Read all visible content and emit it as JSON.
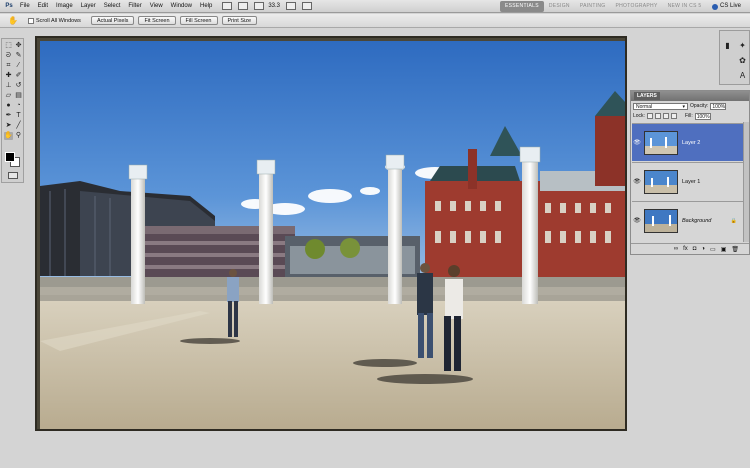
{
  "app": {
    "logo": "Ps"
  },
  "menu": [
    "File",
    "Edit",
    "Image",
    "Layer",
    "Select",
    "Filter",
    "View",
    "Window",
    "Help"
  ],
  "zoom": "33.3",
  "workspaces": [
    {
      "label": "ESSENTIALS",
      "active": true
    },
    {
      "label": "DESIGN",
      "active": false
    },
    {
      "label": "PAINTING",
      "active": false
    },
    {
      "label": "PHOTOGRAPHY",
      "active": false
    },
    {
      "label": "NEW IN CS 5",
      "active": false
    }
  ],
  "cs_live": "CS Live",
  "options": {
    "scroll_all_label": "Scroll All Windows",
    "buttons": [
      "Actual Pixels",
      "Fit Screen",
      "Fill Screen",
      "Print Size"
    ]
  },
  "layers_panel": {
    "tab": "LAYERS",
    "blend_mode": "Normal",
    "opacity_label": "Opacity:",
    "opacity_value": "100%",
    "lock_label": "Lock:",
    "fill_label": "Fill:",
    "fill_value": "100%",
    "layers": [
      {
        "name": "Layer 2",
        "selected": true
      },
      {
        "name": "Layer 1",
        "selected": false
      },
      {
        "name": "Background",
        "selected": false,
        "locked": true
      }
    ]
  },
  "colors": {
    "selection": "#4f6fbf",
    "sky": "#3a78c9"
  }
}
